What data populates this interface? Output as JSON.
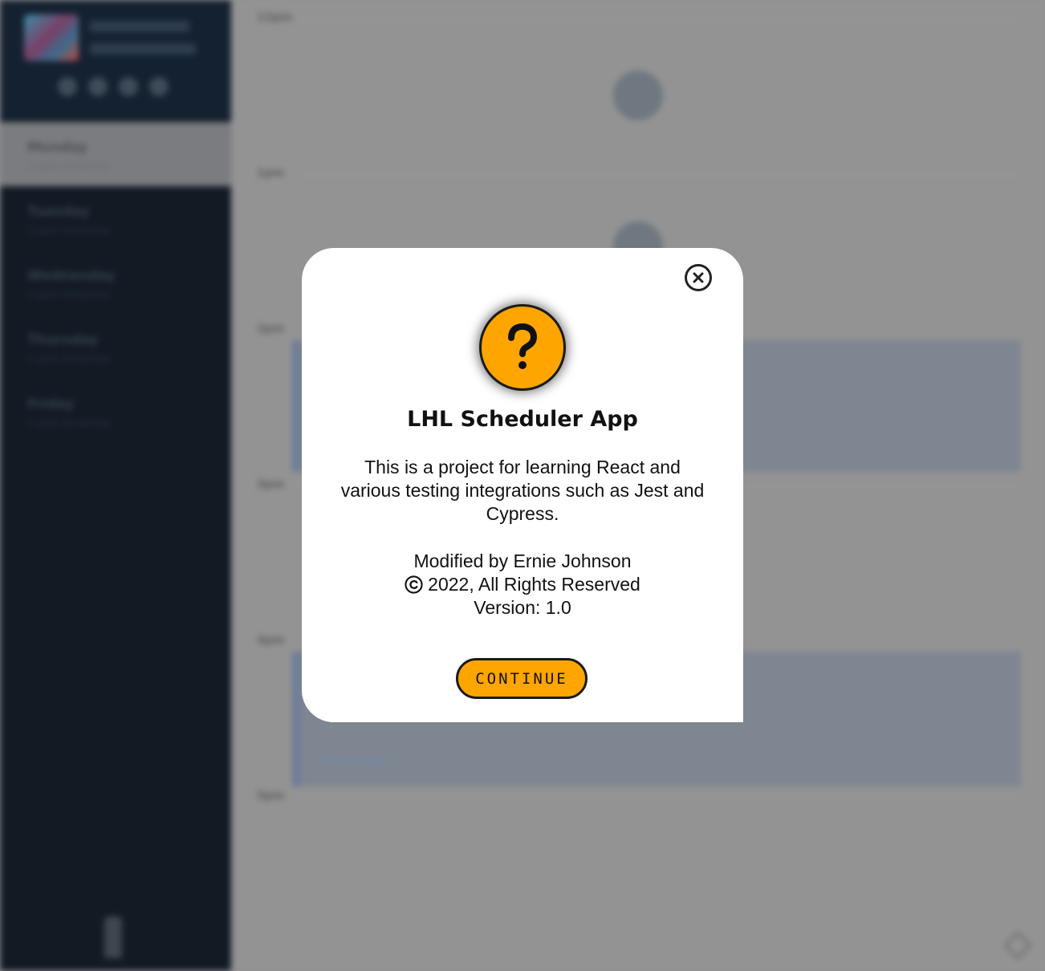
{
  "sidebar": {
    "days": [
      {
        "name": "Monday",
        "spots": "1 spot remaining",
        "selected": true
      },
      {
        "name": "Tuesday",
        "spots": "1 spot remaining",
        "selected": false
      },
      {
        "name": "Wednesday",
        "spots": "1 spot remaining",
        "selected": false
      },
      {
        "name": "Thursday",
        "spots": "1 spot remaining",
        "selected": false
      },
      {
        "name": "Friday",
        "spots": "1 spot remaining",
        "selected": false
      }
    ]
  },
  "schedule": {
    "times": [
      "12pm",
      "1pm",
      "2pm",
      "3pm",
      "4pm",
      "5pm"
    ],
    "appointment_interviewer": "Interviewer"
  },
  "modal": {
    "title": "LHL Scheduler App",
    "description": "This is a project for learning React and various testing integrations such as Jest and Cypress.",
    "modified_by": "Modified by Ernie Johnson",
    "copyright": "2022, All Rights Reserved",
    "version": "Version: 1.0",
    "continue_label": "CONTINUE",
    "badge_icon": "question-icon",
    "close_icon": "close-icon"
  },
  "colors": {
    "accent": "#ffa500",
    "sidebar_bg": "#121a24",
    "overlay_bg": "#939393"
  }
}
